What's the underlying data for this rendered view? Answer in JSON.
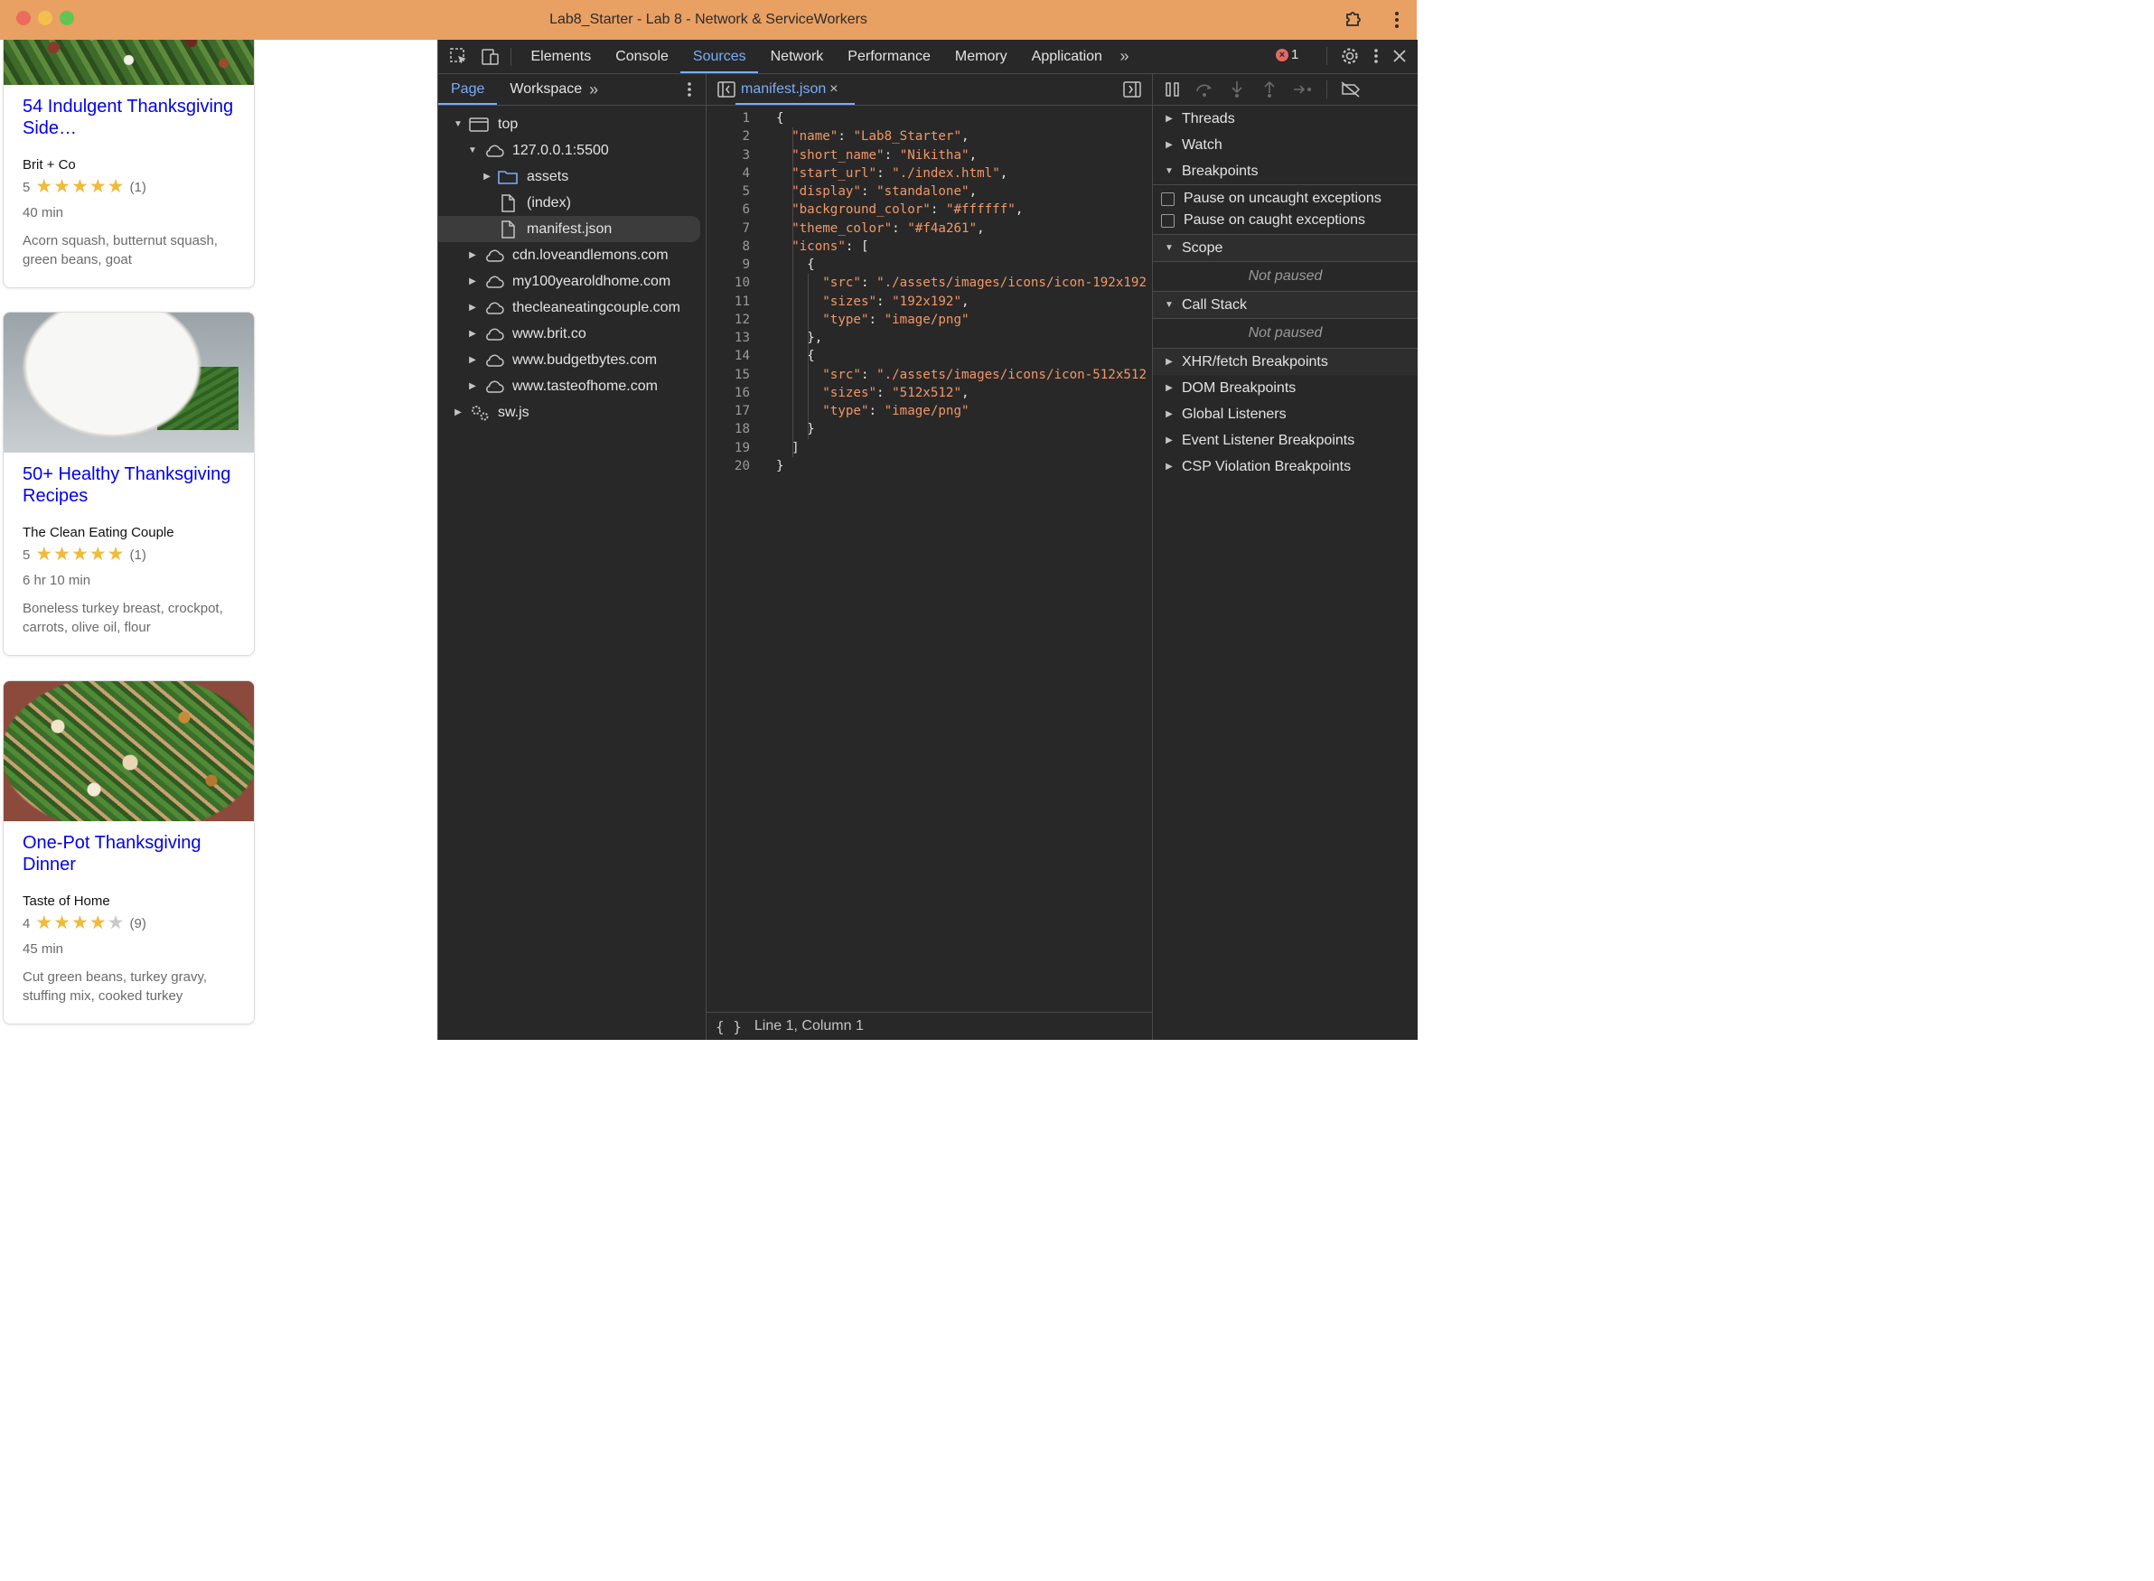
{
  "window": {
    "title": "Lab8_Starter - Lab 8 - Network & ServiceWorkers"
  },
  "page": {
    "cards": [
      {
        "title": "54 Indulgent Thanksgiving Side…",
        "org": "Brit + Co",
        "rating": "5",
        "stars": 5,
        "count": "(1)",
        "time": "40 min",
        "ingredients": "Acorn squash, butternut squash, green beans, goat"
      },
      {
        "title": "50+ Healthy Thanksgiving Recipes",
        "org": "The Clean Eating Couple",
        "rating": "5",
        "stars": 5,
        "count": "(1)",
        "time": "6 hr 10 min",
        "ingredients": "Boneless turkey breast, crockpot, carrots, olive oil, flour"
      },
      {
        "title": "One-Pot Thanksgiving Dinner",
        "org": "Taste of Home",
        "rating": "4",
        "stars": 4,
        "count": "(9)",
        "time": "45 min",
        "ingredients": "Cut green beans, turkey gravy, stuffing mix, cooked turkey"
      }
    ]
  },
  "devtools": {
    "tabs": [
      "Elements",
      "Console",
      "Sources",
      "Network",
      "Performance",
      "Memory",
      "Application"
    ],
    "active_tab": "Sources",
    "more": "»",
    "error_count": "1",
    "navigator": {
      "tabs": [
        "Page",
        "Workspace"
      ],
      "more": "»",
      "tree": [
        {
          "label": "top",
          "indent": 0,
          "arrow": "down",
          "icon": "frame"
        },
        {
          "label": "127.0.0.1:5500",
          "indent": 1,
          "arrow": "down",
          "icon": "cloud"
        },
        {
          "label": "assets",
          "indent": 2,
          "arrow": "right",
          "icon": "folder"
        },
        {
          "label": "(index)",
          "indent": 2,
          "arrow": "none",
          "icon": "file"
        },
        {
          "label": "manifest.json",
          "indent": 2,
          "arrow": "none",
          "icon": "file",
          "selected": true
        },
        {
          "label": "cdn.loveandlemons.com",
          "indent": 1,
          "arrow": "right",
          "icon": "cloud"
        },
        {
          "label": "my100yearoldhome.com",
          "indent": 1,
          "arrow": "right",
          "icon": "cloud"
        },
        {
          "label": "thecleaneatingcouple.com",
          "indent": 1,
          "arrow": "right",
          "icon": "cloud"
        },
        {
          "label": "www.brit.co",
          "indent": 1,
          "arrow": "right",
          "icon": "cloud"
        },
        {
          "label": "www.budgetbytes.com",
          "indent": 1,
          "arrow": "right",
          "icon": "cloud"
        },
        {
          "label": "www.tasteofhome.com",
          "indent": 1,
          "arrow": "right",
          "icon": "cloud"
        },
        {
          "label": "sw.js",
          "indent": 0,
          "arrow": "right",
          "icon": "gears"
        }
      ]
    },
    "editor": {
      "file_tab": "manifest.json",
      "close": "×",
      "lines": [
        "{",
        "  \"name\": \"Lab8_Starter\",",
        "  \"short_name\": \"Nikitha\",",
        "  \"start_url\": \"./index.html\",",
        "  \"display\": \"standalone\",",
        "  \"background_color\": \"#ffffff\",",
        "  \"theme_color\": \"#f4a261\",",
        "  \"icons\": [",
        "    {",
        "      \"src\": \"./assets/images/icons/icon-192x192",
        "      \"sizes\": \"192x192\",",
        "      \"type\": \"image/png\"",
        "    },",
        "    {",
        "      \"src\": \"./assets/images/icons/icon-512x512",
        "      \"sizes\": \"512x512\",",
        "      \"type\": \"image/png\"",
        "    }",
        "  ]",
        "}"
      ],
      "status": "Line 1, Column 1",
      "format_icon": "{ }"
    },
    "debugger": {
      "threads": "Threads",
      "watch": "Watch",
      "breakpoints": "Breakpoints",
      "pause_uncaught": "Pause on uncaught exceptions",
      "pause_caught": "Pause on caught exceptions",
      "scope": "Scope",
      "not_paused_1": "Not paused",
      "call_stack": "Call Stack",
      "not_paused_2": "Not paused",
      "xhr": "XHR/fetch Breakpoints",
      "dom": "DOM Breakpoints",
      "global": "Global Listeners",
      "event": "Event Listener Breakpoints",
      "csp": "CSP Violation Breakpoints"
    }
  }
}
